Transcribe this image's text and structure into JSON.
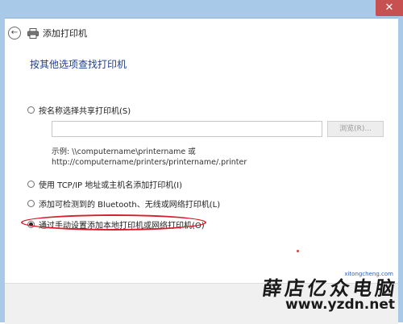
{
  "window": {
    "title": "添加打印机",
    "close_symbol": "✕"
  },
  "section_title": "按其他选项查找打印机",
  "options": [
    {
      "label": "按名称选择共享打印机(S)",
      "checked": false
    },
    {
      "label": "使用 TCP/IP 地址或主机名添加打印机(I)",
      "checked": false
    },
    {
      "label": "添加可检测到的 Bluetooth、无线或网络打印机(L)",
      "checked": false
    },
    {
      "label": "通过手动设置添加本地打印机或网络打印机(O)",
      "checked": true
    }
  ],
  "share_input": {
    "value": "",
    "placeholder": ""
  },
  "browse_button": {
    "label": "浏览(R)..."
  },
  "example": {
    "line1": "示例: \\\\computername\\printername 或",
    "line2": "http://computername/printers/printername/.printer"
  },
  "watermark": {
    "brand": "薛店亿众电脑",
    "url": "www.yzdn.net",
    "small": "xitongcheng.com"
  },
  "colors": {
    "accent": "#1e3f8f",
    "highlight": "#d81e2c",
    "close": "#c75050"
  },
  "icons": {
    "back": "back-arrow-icon",
    "printer": "printer-icon"
  }
}
